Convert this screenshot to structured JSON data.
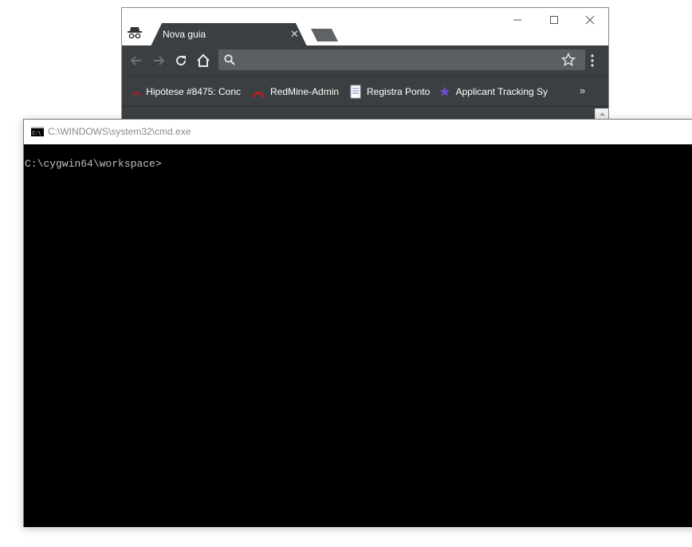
{
  "chrome": {
    "tab": {
      "title": "Nova guia",
      "close_glyph": "✕"
    },
    "window_controls": {
      "minimize_icon": "minimize-icon",
      "maximize_icon": "maximize-icon",
      "close_icon": "close-icon"
    },
    "toolbar": {
      "icons": [
        "back-arrow-icon",
        "forward-arrow-icon",
        "reload-icon",
        "home-icon"
      ],
      "omnibox_value": "",
      "omnibox_placeholder": ""
    },
    "bookmarks": [
      {
        "label": "Hipótese #8475: Conc",
        "icon": "redmine-icon"
      },
      {
        "label": "RedMine-Admin",
        "icon": "redmine-icon"
      },
      {
        "label": "Registra Ponto",
        "icon": "document-icon"
      },
      {
        "label": "Applicant Tracking Sy",
        "icon": "star-icon"
      }
    ],
    "bookmarks_overflow": "»"
  },
  "cmd": {
    "title": "C:\\WINDOWS\\system32\\cmd.exe",
    "prompt": "C:\\cygwin64\\workspace>"
  },
  "colors": {
    "chrome_dark": "#3c3f41",
    "omnibox": "#5c5f62",
    "console_bg": "#000000",
    "console_text": "#c0c0c0",
    "redmine_red": "#b32024",
    "star_purple": "#6a4fc1"
  }
}
